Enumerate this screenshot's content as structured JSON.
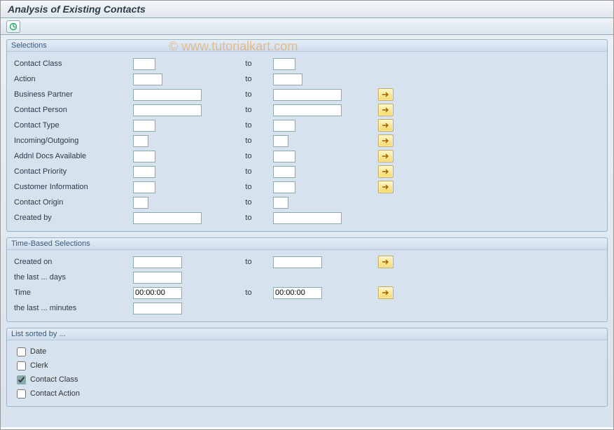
{
  "header": {
    "title": "Analysis of Existing Contacts"
  },
  "watermark": "© www.tutorialkart.com",
  "to_label": "to",
  "groups": {
    "sel_title": "Selections",
    "time_title": "Time-Based Selections",
    "sort_title": "List sorted by ..."
  },
  "selections": [
    {
      "label": "Contact Class",
      "from_w": "w-sm",
      "to_w": "w-sm",
      "more": false
    },
    {
      "label": "Action",
      "from_w": "w-ssm",
      "to_w": "w-ssm",
      "more": false
    },
    {
      "label": "Business Partner",
      "from_w": "w-lg",
      "to_w": "w-lg",
      "more": true
    },
    {
      "label": "Contact Person",
      "from_w": "w-lg",
      "to_w": "w-lg",
      "more": true
    },
    {
      "label": "Contact Type",
      "from_w": "w-sm",
      "to_w": "w-sm",
      "more": true
    },
    {
      "label": "Incoming/Outgoing",
      "from_w": "w-xs",
      "to_w": "w-xs",
      "more": true
    },
    {
      "label": "Addnl Docs Available",
      "from_w": "w-sm",
      "to_w": "w-sm",
      "more": true
    },
    {
      "label": "Contact Priority",
      "from_w": "w-sm",
      "to_w": "w-sm",
      "more": true
    },
    {
      "label": "Customer Information",
      "from_w": "w-sm",
      "to_w": "w-sm",
      "more": true
    },
    {
      "label": "Contact Origin",
      "from_w": "w-xs",
      "to_w": "w-xs",
      "more": false
    },
    {
      "label": "Created by",
      "from_w": "w-lg",
      "to_w": "w-lg",
      "more": false
    }
  ],
  "time_selections": [
    {
      "label": "Created on",
      "from_w": "w-md",
      "from_val": "",
      "to": true,
      "to_w": "w-md",
      "to_val": "",
      "more": true
    },
    {
      "label": "the last ... days",
      "from_w": "w-md",
      "from_val": "",
      "to": false,
      "to_w": "",
      "to_val": "",
      "more": false
    },
    {
      "label": "Time",
      "from_w": "w-md",
      "from_val": "00:00:00",
      "to": true,
      "to_w": "w-md",
      "to_val": "00:00:00",
      "more": true
    },
    {
      "label": "the last ... minutes",
      "from_w": "w-md",
      "from_val": "",
      "to": false,
      "to_w": "",
      "to_val": "",
      "more": false
    }
  ],
  "sort_options": [
    {
      "label": "Date",
      "checked": false
    },
    {
      "label": "Clerk",
      "checked": false
    },
    {
      "label": "Contact Class",
      "checked": true
    },
    {
      "label": "Contact Action",
      "checked": false
    }
  ]
}
